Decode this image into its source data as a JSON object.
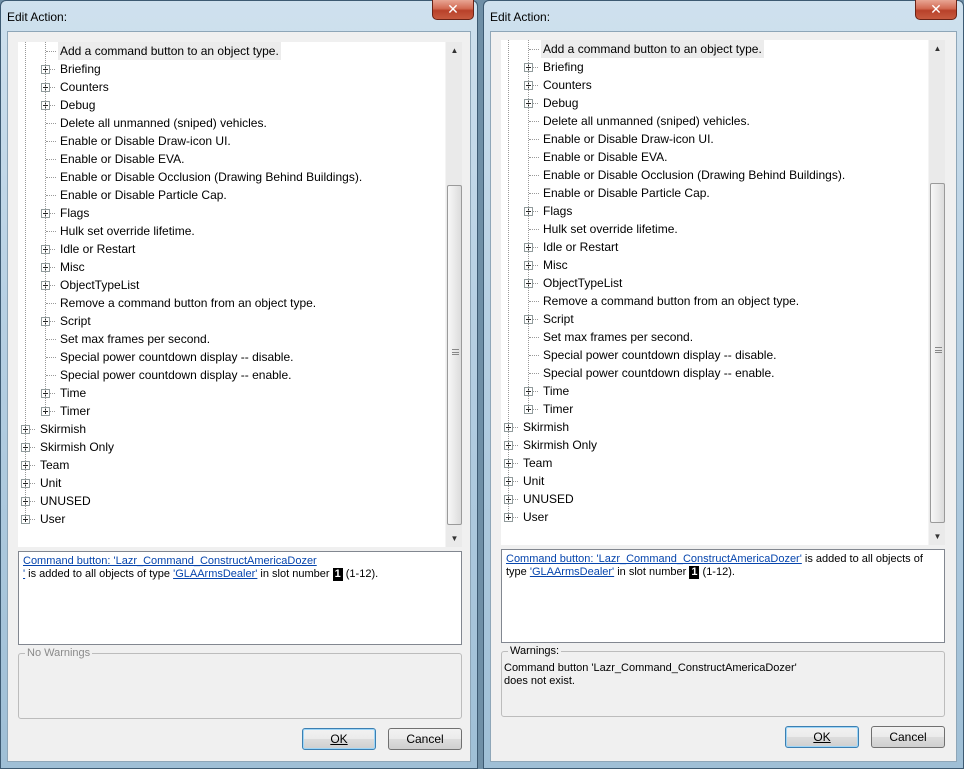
{
  "dialogs": [
    {
      "title": "Edit Action:",
      "close_glyph": "✕",
      "tree_items": [
        {
          "label": "Add a command button to an object type.",
          "level": 2,
          "expandable": false,
          "selected": true
        },
        {
          "label": "Briefing",
          "level": 2,
          "expandable": true
        },
        {
          "label": "Counters",
          "level": 2,
          "expandable": true
        },
        {
          "label": "Debug",
          "level": 2,
          "expandable": true
        },
        {
          "label": "Delete all unmanned (sniped) vehicles.",
          "level": 2,
          "expandable": false
        },
        {
          "label": "Enable or Disable Draw-icon UI.",
          "level": 2,
          "expandable": false
        },
        {
          "label": "Enable or Disable EVA.",
          "level": 2,
          "expandable": false
        },
        {
          "label": "Enable or Disable Occlusion (Drawing Behind Buildings).",
          "level": 2,
          "expandable": false
        },
        {
          "label": "Enable or Disable Particle Cap.",
          "level": 2,
          "expandable": false
        },
        {
          "label": "Flags",
          "level": 2,
          "expandable": true
        },
        {
          "label": "Hulk set override lifetime.",
          "level": 2,
          "expandable": false
        },
        {
          "label": "Idle or Restart",
          "level": 2,
          "expandable": true
        },
        {
          "label": "Misc",
          "level": 2,
          "expandable": true
        },
        {
          "label": "ObjectTypeList",
          "level": 2,
          "expandable": true
        },
        {
          "label": "Remove a command button from an object type.",
          "level": 2,
          "expandable": false
        },
        {
          "label": "Script",
          "level": 2,
          "expandable": true
        },
        {
          "label": "Set max frames per second.",
          "level": 2,
          "expandable": false
        },
        {
          "label": "Special power countdown display -- disable.",
          "level": 2,
          "expandable": false
        },
        {
          "label": "Special power countdown display -- enable.",
          "level": 2,
          "expandable": false
        },
        {
          "label": "Time",
          "level": 2,
          "expandable": true
        },
        {
          "label": "Timer",
          "level": 2,
          "expandable": true
        },
        {
          "label": "Skirmish",
          "level": 1,
          "expandable": true
        },
        {
          "label": "Skirmish Only",
          "level": 1,
          "expandable": true
        },
        {
          "label": "Team",
          "level": 1,
          "expandable": true
        },
        {
          "label": "Unit",
          "level": 1,
          "expandable": true
        },
        {
          "label": "UNUSED",
          "level": 1,
          "expandable": true
        },
        {
          "label": "User",
          "level": 1,
          "expandable": true
        }
      ],
      "scroll_up_glyph": "▲",
      "scroll_down_glyph": "▼",
      "description": {
        "link1": "Command button: 'Lazr_Command_ConstructAmericaDozer",
        "link1_tail": "'",
        "text1": " is added to all objects of type ",
        "link2": "'GLAArmsDealer'",
        "text2": " in slot number ",
        "slot": "1",
        "text3": " (1-12)."
      },
      "warnings_label": "No Warnings",
      "warnings_text": "",
      "ok_label": "OK",
      "cancel_label": "Cancel"
    },
    {
      "title": "Edit Action:",
      "close_glyph": "✕",
      "tree_items": [
        {
          "label": "Add a command button to an object type.",
          "level": 2,
          "expandable": false,
          "selected": true
        },
        {
          "label": "Briefing",
          "level": 2,
          "expandable": true
        },
        {
          "label": "Counters",
          "level": 2,
          "expandable": true
        },
        {
          "label": "Debug",
          "level": 2,
          "expandable": true
        },
        {
          "label": "Delete all unmanned (sniped) vehicles.",
          "level": 2,
          "expandable": false
        },
        {
          "label": "Enable or Disable Draw-icon UI.",
          "level": 2,
          "expandable": false
        },
        {
          "label": "Enable or Disable EVA.",
          "level": 2,
          "expandable": false
        },
        {
          "label": "Enable or Disable Occlusion (Drawing Behind Buildings).",
          "level": 2,
          "expandable": false
        },
        {
          "label": "Enable or Disable Particle Cap.",
          "level": 2,
          "expandable": false
        },
        {
          "label": "Flags",
          "level": 2,
          "expandable": true
        },
        {
          "label": "Hulk set override lifetime.",
          "level": 2,
          "expandable": false
        },
        {
          "label": "Idle or Restart",
          "level": 2,
          "expandable": true
        },
        {
          "label": "Misc",
          "level": 2,
          "expandable": true
        },
        {
          "label": "ObjectTypeList",
          "level": 2,
          "expandable": true
        },
        {
          "label": "Remove a command button from an object type.",
          "level": 2,
          "expandable": false
        },
        {
          "label": "Script",
          "level": 2,
          "expandable": true
        },
        {
          "label": "Set max frames per second.",
          "level": 2,
          "expandable": false
        },
        {
          "label": "Special power countdown display -- disable.",
          "level": 2,
          "expandable": false
        },
        {
          "label": "Special power countdown display -- enable.",
          "level": 2,
          "expandable": false
        },
        {
          "label": "Time",
          "level": 2,
          "expandable": true
        },
        {
          "label": "Timer",
          "level": 2,
          "expandable": true
        },
        {
          "label": "Skirmish",
          "level": 1,
          "expandable": true
        },
        {
          "label": "Skirmish Only",
          "level": 1,
          "expandable": true
        },
        {
          "label": "Team",
          "level": 1,
          "expandable": true
        },
        {
          "label": "Unit",
          "level": 1,
          "expandable": true
        },
        {
          "label": "UNUSED",
          "level": 1,
          "expandable": true
        },
        {
          "label": "User",
          "level": 1,
          "expandable": true
        }
      ],
      "scroll_up_glyph": "▲",
      "scroll_down_glyph": "▼",
      "description": {
        "link1": "Command button: 'Lazr_Command_ConstructAmericaDozer'",
        "link1_tail": "",
        "text1": " is added to all objects of type ",
        "link2": "'GLAArmsDealer'",
        "text2": " in slot number ",
        "slot": "1",
        "text3": " (1-12)."
      },
      "warnings_label": "Warnings:",
      "warnings_text": "Command button 'Lazr_Command_ConstructAmericaDozer' does not exist.",
      "ok_label": "OK",
      "cancel_label": "Cancel"
    }
  ]
}
